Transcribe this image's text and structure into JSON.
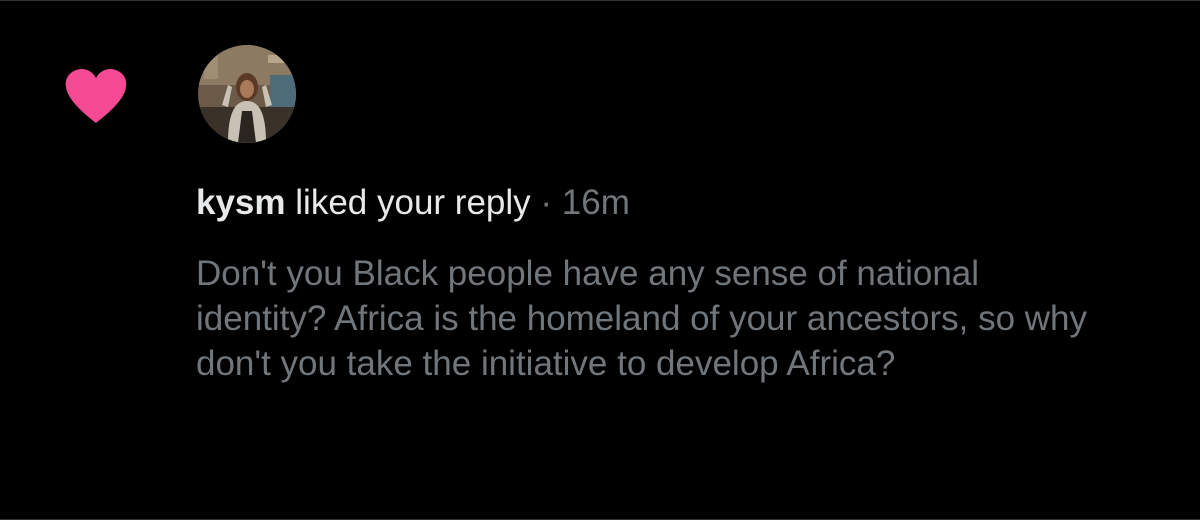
{
  "notification": {
    "type_icon": "heart-icon",
    "icon_color": "#f91880",
    "avatar": "user-avatar",
    "username": "kysm",
    "action": "liked your reply",
    "separator": "·",
    "time": "16m",
    "reply_text": "Don't you Black people have any sense of national identity? Africa is the homeland of your ancestors, so why don't you take the initiative to develop Africa?"
  },
  "colors": {
    "background": "#000000",
    "primary_text": "#e7e9ea",
    "secondary_text": "#71767b",
    "like_pink": "#f91880"
  }
}
